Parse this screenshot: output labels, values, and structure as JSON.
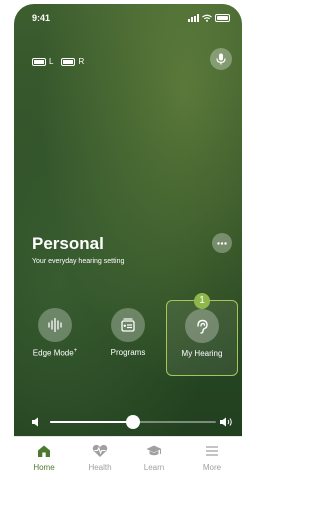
{
  "status_bar": {
    "time": "9:41"
  },
  "hearing_aids": {
    "left_label": "L",
    "right_label": "R"
  },
  "program": {
    "title": "Personal",
    "subtitle": "Your everyday hearing setting"
  },
  "modes": [
    {
      "label": "Edge Mode",
      "superscript": "+",
      "icon": "edge-mode-icon"
    },
    {
      "label": "Programs",
      "icon": "programs-icon"
    },
    {
      "label": "My Hearing",
      "icon": "my-hearing-icon",
      "badge": "1",
      "selected": true
    }
  ],
  "volume": {
    "level_fraction": 0.5
  },
  "tabs": [
    {
      "label": "Home",
      "icon": "home-icon",
      "active": true
    },
    {
      "label": "Health",
      "icon": "heart-pulse-icon"
    },
    {
      "label": "Learn",
      "icon": "graduation-cap-icon"
    },
    {
      "label": "More",
      "icon": "menu-icon"
    }
  ],
  "colors": {
    "accent": "#4b7a2e",
    "selection_border": "#a6c65a",
    "badge": "#8fb64c",
    "background_dark": "#2f4f27"
  }
}
